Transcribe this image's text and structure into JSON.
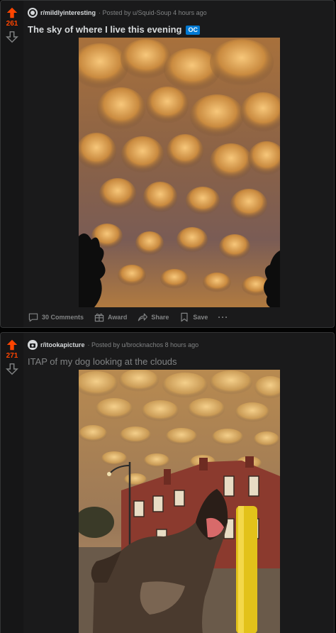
{
  "posts": [
    {
      "score": "261",
      "subreddit": "r/mildlyinteresting",
      "posted_by": "· Posted by u/Squid-Soup 4 hours ago",
      "title": "The sky of where I live this evening",
      "flair": "OC",
      "actions": {
        "comments": "30 Comments",
        "award": "Award",
        "share": "Share",
        "save": "Save",
        "more": "···"
      }
    },
    {
      "score": "271",
      "subreddit": "r/itookapicture",
      "posted_by": "· Posted by u/brocknachos 8 hours ago",
      "title": "ITAP of my dog looking at the clouds"
    }
  ],
  "colors": {
    "upvote": "#ff4500",
    "flair": "#0079d3",
    "background": "#030303",
    "card": "#1a1a1b"
  }
}
